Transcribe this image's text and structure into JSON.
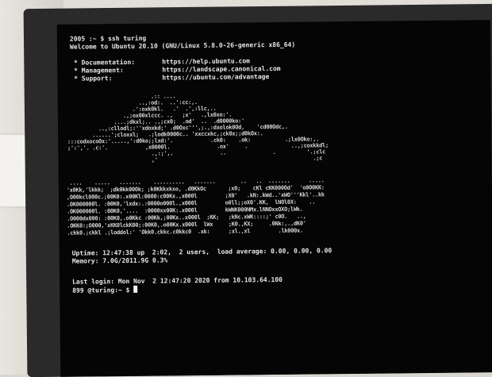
{
  "terminal": {
    "cmd_line": "2005 :~ $ ssh turing",
    "welcome": "Welcome to Ubuntu 20.10 (GNU/Linux 5.8.0-26-generic x86_64)",
    "links": [
      {
        "label": " * Documentation:",
        "url": "https://help.ubuntu.com"
      },
      {
        "label": " * Management:",
        "url": "https://landscape.canonical.com"
      },
      {
        "label": " * Support:",
        "url": "https://ubuntu.com/advantage"
      }
    ],
    "ascii_art": [
      "                              .:: ....",
      "                          ..,:od:.  ..':cc:,.",
      "                        .':oxk0kl.   .'  .',:llc,..",
      "                     .,;ox00xlccc. .,   ;x'   .,lx0xo:'.",
      "                  ....;dkxl;.. .,;cx0;  .od'  ..  .d0000ko:'",
      "             ..,:cllodl;:''xdoxkd;' .d0Oxc''',;.,:dxolok0Od,    'cd00Odc,.",
      "           ......';cloxxl;   .;lodk0000c.. 'xxccxkc,;ck0x;;d0kOx:.",
      "   :::codxocoOx:'.....,':d0ko;;lxd:'.            .ck0:    .ok:           .;lx0Oko:,.",
      "   ;':','. .c:'.            ,x0000l.               .ox'     .              ..,;coxkkdl;",
      "                              .,:;',.               ..               .          '.;clc",
      "                              ,'                                                  .;c",
      "",
      "  ....    .....   .......    ..........   .......        ..   ..  .......      .....",
      " 'x0Kk,'lkkk;  ;dk0kk00Ok; ;k0Kkkxkxo, .d0KkOc       ;x0;    cKl cKK000Od'  'o0O0KK:",
      " ,O00kcl000c.;00K0:.x00Kl:0000:c00Kx.,x000l         ;X0'   .kN:.kWd..'xWO'''Kkl'..kk",
      " .OK000000l. :00K0,'lxdx:.:0000o000l.,x000l         o0ll;;oX0'.KK,  lNOl0X:    ..",
      " .OK000000l. :00K0,'....  :0000xx00K:.x000l         kWNK000NMx.lNNOxxOXO;lWk.",
      " .O000dx000: :00K0,.o0Kkc :00Kk,;00Kx..x000l  ;KK;   ;kNc.xWK::::;' c0O.   ..,",
      " .OKK0:;O000,'xKK0lckK00;:00K0,.o00Kx.x000l  lWx     ;K0.,KX;     .0Nk:,.,dK0'",
      " .ckk0.;ckkl .;loddol:' 'Okk0.ckkc.c0kkc0  .xk:      ;xl.,xl         .lk000x.",
      "",
      "Uptime: 12:47:38 up  2:02,  2 users,  load average: 0.00, 0.00, 0.00",
      "Memory: 7.0G/2011.9G 0.3%"
    ],
    "last_login": "Last login: Mon Nov  2 12:47:20 2020 from 10.103.64.100",
    "prompt": "899 @turing:~ $ "
  }
}
